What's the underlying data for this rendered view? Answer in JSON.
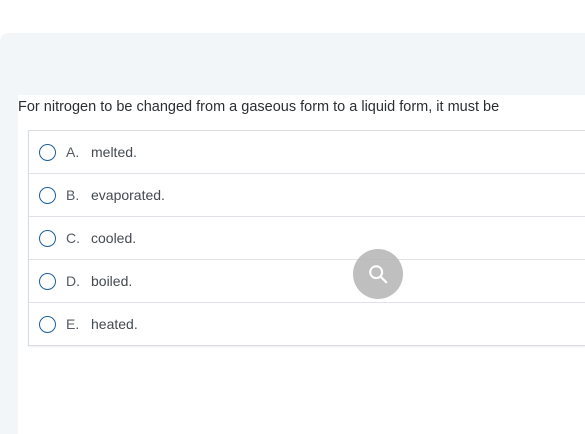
{
  "question": {
    "text": "For nitrogen to be changed from a gaseous form to a liquid form, it must be"
  },
  "choices": [
    {
      "letter": "A.",
      "text": "melted."
    },
    {
      "letter": "B.",
      "text": "evaporated."
    },
    {
      "letter": "C.",
      "text": "cooled."
    },
    {
      "letter": "D.",
      "text": "boiled."
    },
    {
      "letter": "E.",
      "text": "heated."
    }
  ],
  "overlay": {
    "icon": "search-icon"
  },
  "colors": {
    "radio_border": "#1f5f9e",
    "panel_background": "#f3f6f9",
    "overlay_button": "#b4b4b4"
  }
}
